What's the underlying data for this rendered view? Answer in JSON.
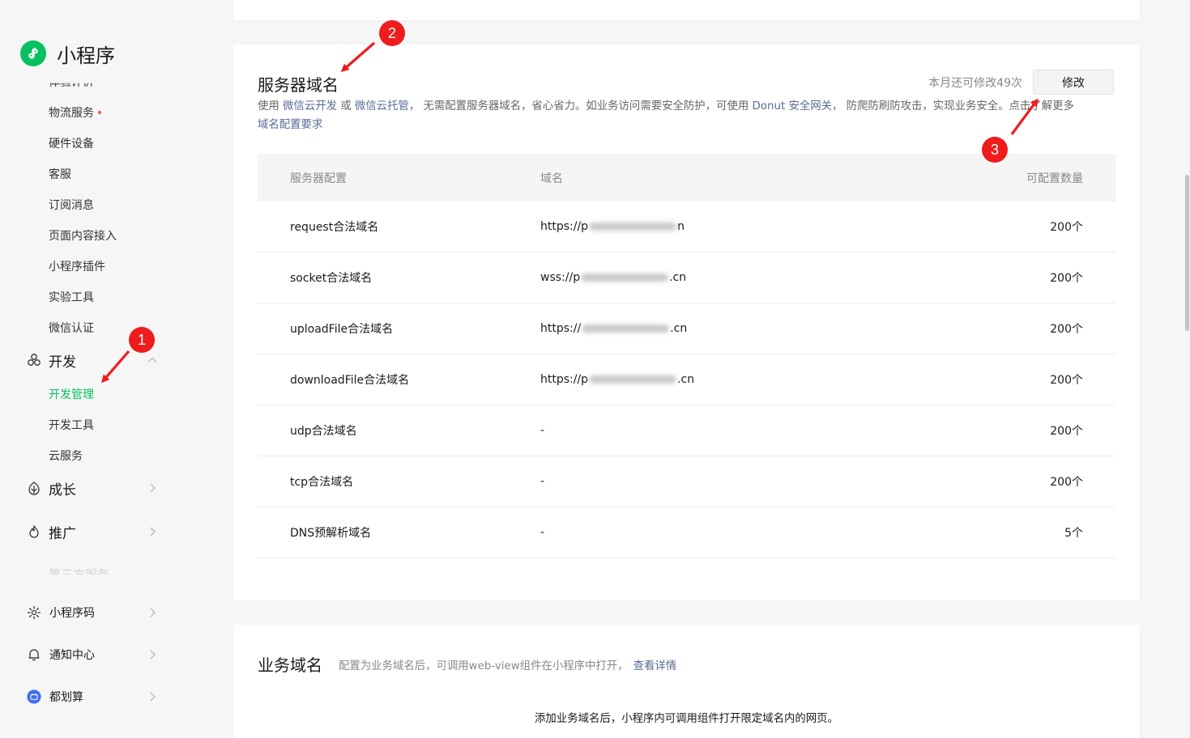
{
  "brand": {
    "name": "小程序"
  },
  "sidebar": {
    "partial_item": "体验评价",
    "items": [
      {
        "label": "物流服务",
        "has_dot": true
      },
      {
        "label": "硬件设备"
      },
      {
        "label": "客服"
      },
      {
        "label": "订阅消息"
      },
      {
        "label": "页面内容接入"
      },
      {
        "label": "小程序插件"
      },
      {
        "label": "实验工具"
      },
      {
        "label": "微信认证"
      }
    ],
    "dev_group": {
      "label": "开发",
      "subitems": [
        "开发管理",
        "开发工具",
        "云服务"
      ],
      "active": "开发管理"
    },
    "groups": [
      {
        "label": "成长",
        "icon": "growth-icon"
      },
      {
        "label": "推广",
        "icon": "promotion-icon"
      }
    ],
    "faded_group": "第三方服务",
    "bottom_groups": [
      {
        "label": "小程序码",
        "icon": "qrcode-icon"
      },
      {
        "label": "通知中心",
        "icon": "bell-icon"
      },
      {
        "label": "都划算",
        "icon": "deal-icon"
      }
    ]
  },
  "server_domain": {
    "title": "服务器域名",
    "quota_text": "本月还可修改49次",
    "modify_button": "修改",
    "desc": {
      "p1": "使用 ",
      "link1": "微信云开发",
      "p2": " 或 ",
      "link2": "微信云托管",
      "p3": "， 无需配置服务器域名，省心省力。如业务访问需要安全防护，可使用 ",
      "link3": "Donut 安全网关",
      "p4": "， 防爬防刷防攻击，实现业务安全。点击了解更多",
      "link4": "域名配置要求"
    },
    "headers": {
      "config": "服务器配置",
      "domain": "域名",
      "count": "可配置数量"
    },
    "rows": [
      {
        "config": "request合法域名",
        "prefix": "https://p",
        "suffix": "n",
        "count": "200个"
      },
      {
        "config": "socket合法域名",
        "prefix": "wss://p",
        "suffix": ".cn",
        "count": "200个"
      },
      {
        "config": "uploadFile合法域名",
        "prefix": "https://",
        "suffix": ".cn",
        "count": "200个"
      },
      {
        "config": "downloadFile合法域名",
        "prefix": "https://p",
        "suffix": ".cn",
        "count": "200个"
      },
      {
        "config": "udp合法域名",
        "prefix": "-",
        "suffix": "",
        "count": "200个"
      },
      {
        "config": "tcp合法域名",
        "prefix": "-",
        "suffix": "",
        "count": "200个"
      },
      {
        "config": "DNS预解析域名",
        "prefix": "-",
        "suffix": "",
        "count": "5个"
      }
    ]
  },
  "business_domain": {
    "title": "业务域名",
    "desc": "配置为业务域名后，可调用web-view组件在小程序中打开，",
    "link": "查看详情",
    "note": "添加业务域名后，小程序内可调用组件打开限定域名内的网页。"
  },
  "annotations": {
    "m1": "1",
    "m2": "2",
    "m3": "3"
  },
  "colors": {
    "accent": "#07c160",
    "link": "#576b95",
    "annotation": "#ee1c1c"
  }
}
